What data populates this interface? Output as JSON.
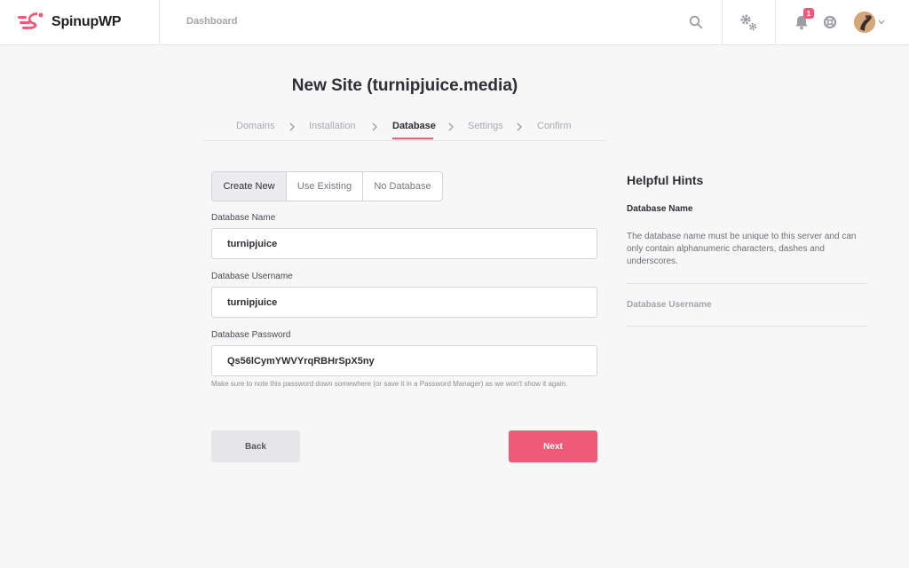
{
  "brand": {
    "name": "SpinupWP",
    "accent": "#ee5a78"
  },
  "header": {
    "nav_dashboard": "Dashboard",
    "notification_count": "1",
    "icons": [
      "search-icon",
      "settings-icon",
      "bell-icon",
      "help-icon",
      "avatar",
      "chevron-down-icon"
    ]
  },
  "page": {
    "title": "New Site (turnipjuice.media)"
  },
  "steps": [
    {
      "label": "Domains"
    },
    {
      "label": "Installation"
    },
    {
      "label": "Database"
    },
    {
      "label": "Settings"
    },
    {
      "label": "Confirm"
    }
  ],
  "db_mode": {
    "options": [
      "Create New",
      "Use Existing",
      "No Database"
    ],
    "selected": "Create New"
  },
  "form": {
    "db_name": {
      "label": "Database Name",
      "value": "turnipjuice"
    },
    "db_user": {
      "label": "Database Username",
      "value": "turnipjuice"
    },
    "db_pass": {
      "label": "Database Password",
      "value": "Qs56lCymYWVYrqRBHrSpX5ny"
    },
    "password_note": "Make sure to note this password down somewhere (or save it in a Password Manager) as we won't show it again.",
    "back_label": "Back",
    "next_label": "Next"
  },
  "hints": {
    "title": "Helpful Hints",
    "items": [
      {
        "heading": "Database Name",
        "body": "The database name must be unique to this server and can only contain alphanumeric characters, dashes and underscores."
      },
      {
        "heading": "Database Username"
      }
    ]
  }
}
